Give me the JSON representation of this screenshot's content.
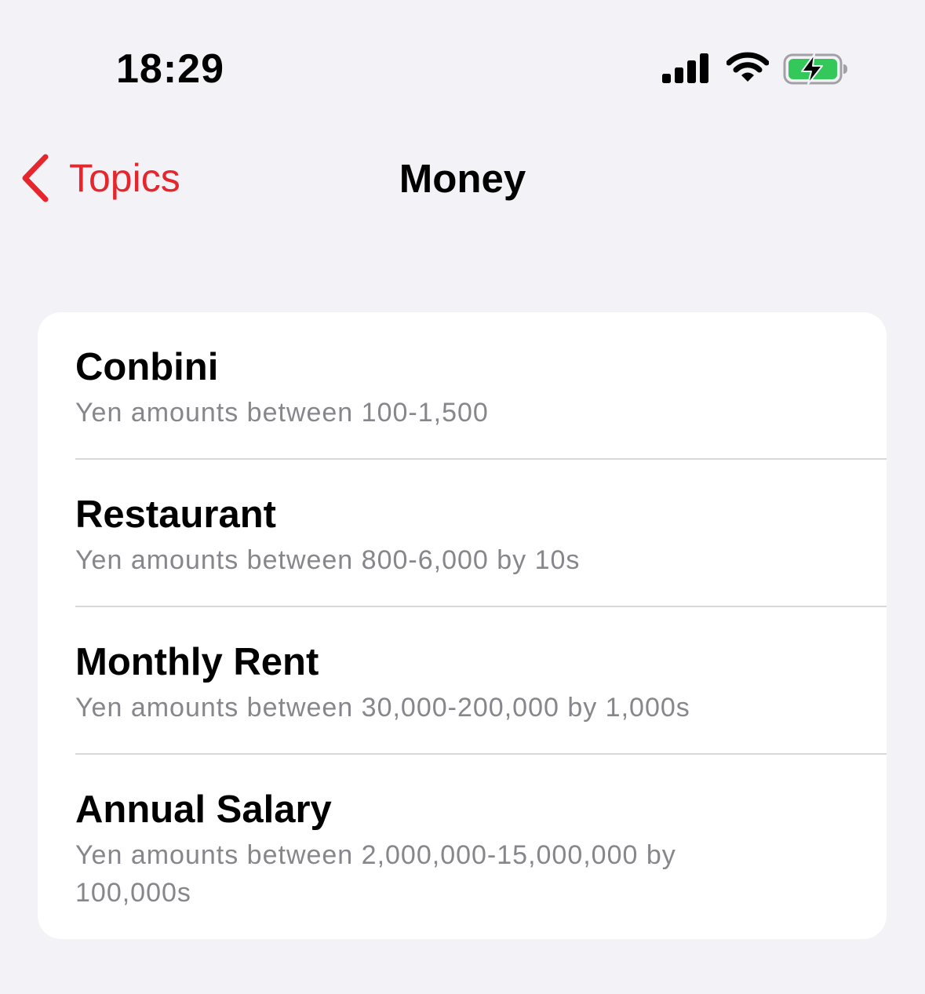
{
  "status_bar": {
    "time": "18:29",
    "icons": [
      "cellular-signal-icon",
      "wifi-icon",
      "battery-charging-icon"
    ],
    "battery_color": "#34c759"
  },
  "nav": {
    "back_label": "Topics",
    "back_icon": "chevron-left-icon",
    "title": "Money",
    "accent_color": "#e5262c"
  },
  "topics": [
    {
      "title": "Conbini",
      "subtitle": "Yen amounts between 100-1,500"
    },
    {
      "title": "Restaurant",
      "subtitle": "Yen amounts between 800-6,000 by 10s"
    },
    {
      "title": "Monthly Rent",
      "subtitle": "Yen amounts between 30,000-200,000 by 1,000s"
    },
    {
      "title": "Annual Salary",
      "subtitle": "Yen amounts between 2,000,000-15,000,000 by 100,000s"
    }
  ]
}
